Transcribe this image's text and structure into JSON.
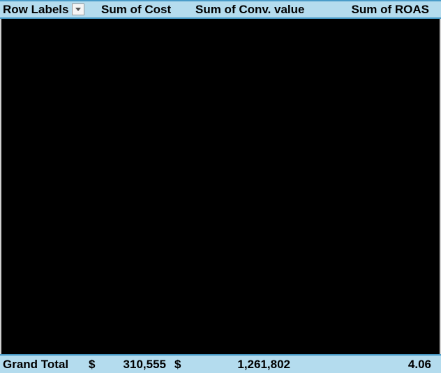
{
  "headers": {
    "row_labels": "Row Labels",
    "cost": "Sum of Cost",
    "conv_value": "Sum of Conv. value",
    "roas": "Sum of ROAS"
  },
  "totals": {
    "label": "Grand Total",
    "currency": "$",
    "cost": "310,555",
    "conv_value": "1,261,802",
    "roas": "4.06"
  }
}
